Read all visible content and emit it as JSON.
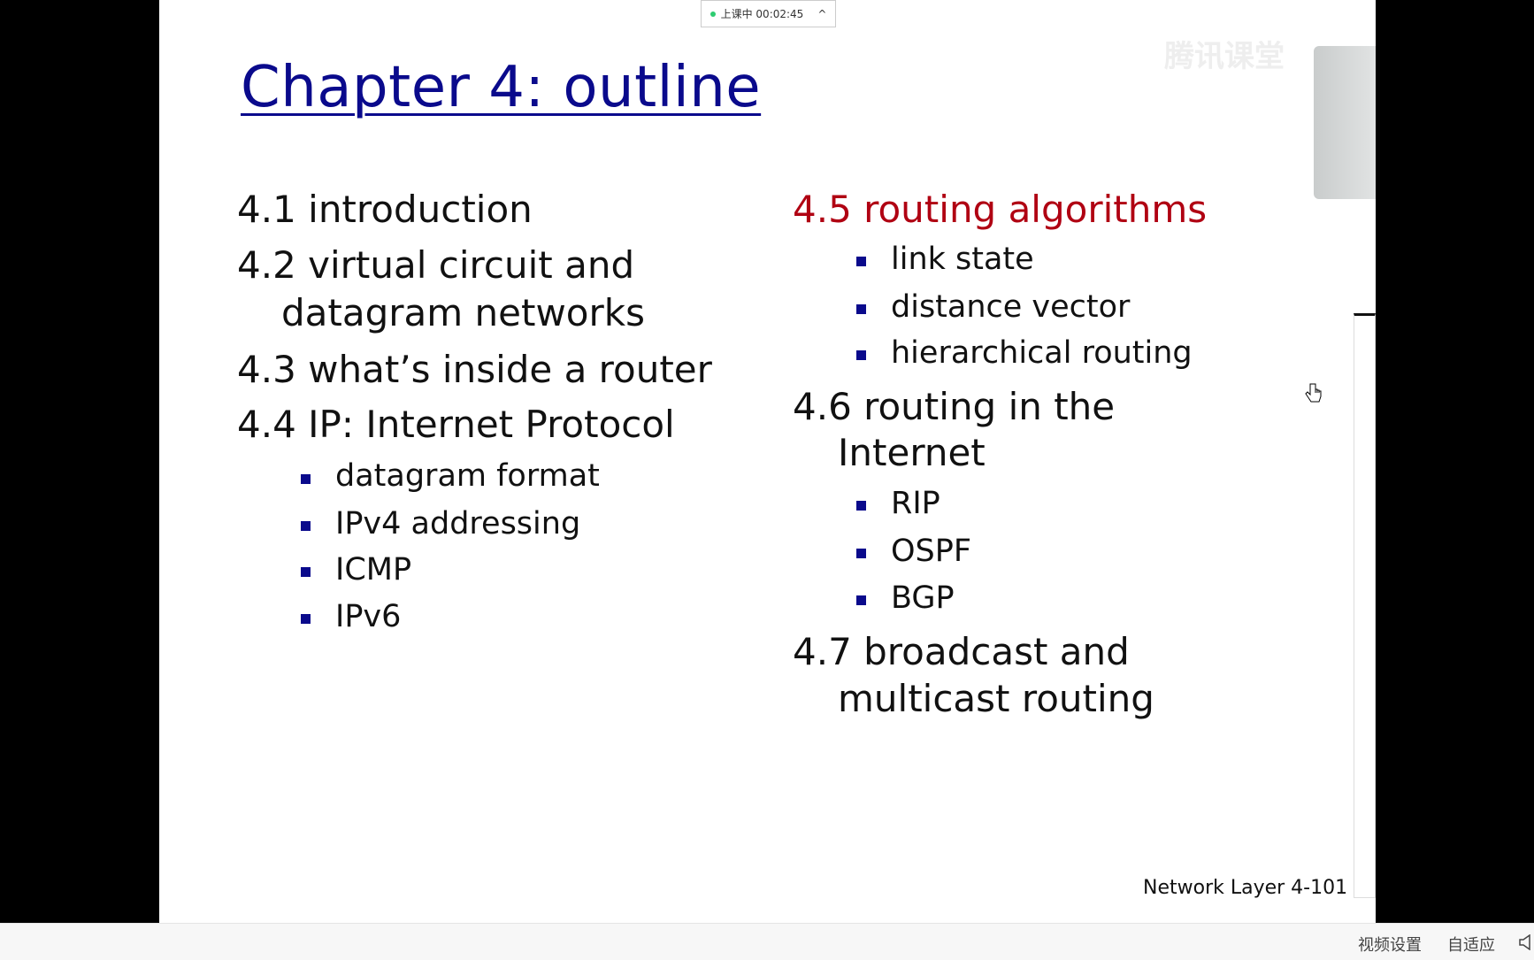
{
  "status_pill": {
    "text": "上课中 00:02:45",
    "chevron": "^"
  },
  "watermark": "腾讯课堂",
  "slide": {
    "title": "Chapter 4: outline",
    "left": [
      {
        "text": "4.1 introduction"
      },
      {
        "text": "4.2 virtual circuit and"
      },
      {
        "text": "datagram networks"
      },
      {
        "text": "4.3 what’s inside a router"
      },
      {
        "text": "4.4 IP: Internet Protocol"
      }
    ],
    "left_bullets": [
      "datagram format",
      "IPv4 addressing",
      "ICMP",
      "IPv6"
    ],
    "right": {
      "s45": "4.5 routing algorithms",
      "s45_bullets": [
        "link state",
        "distance vector",
        "hierarchical routing"
      ],
      "s46a": "4.6 routing in the",
      "s46b": "Internet",
      "s46_bullets": [
        "RIP",
        "OSPF",
        "BGP"
      ],
      "s47a": "4.7 broadcast and",
      "s47b": "multicast routing"
    },
    "footer": "Network Layer  4-101",
    "colors": {
      "title": "#0a0a8c",
      "highlight": "#b00012",
      "bullet": "#0a0a8c"
    }
  },
  "bottom_bar": {
    "video_settings": "视频设置",
    "fit": "自适应",
    "icon": "speaker-icon"
  }
}
